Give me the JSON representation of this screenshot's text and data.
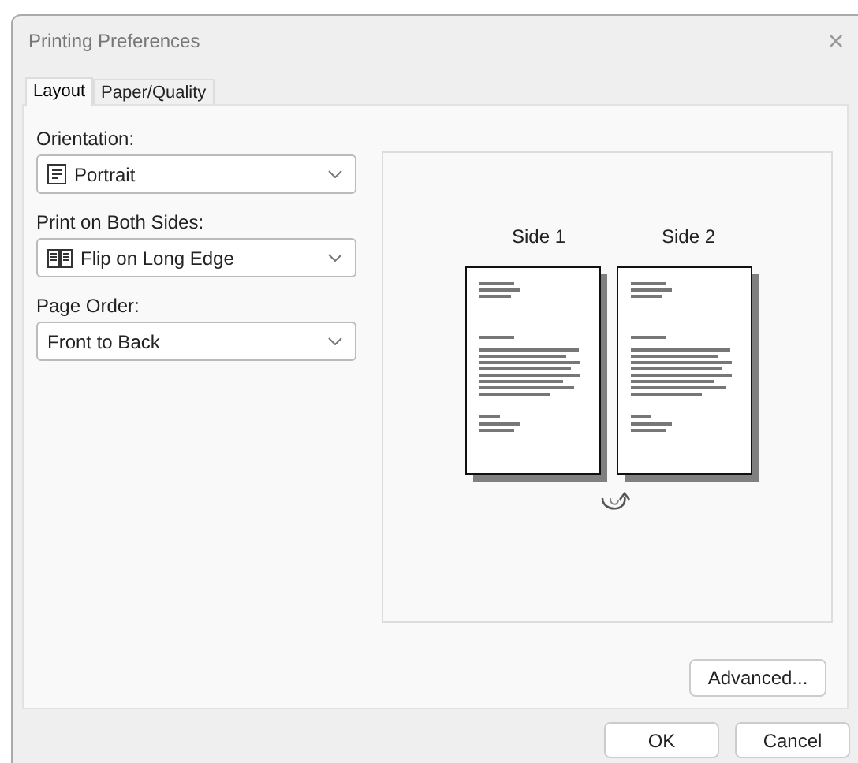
{
  "window": {
    "title": "Printing Preferences",
    "close": "×"
  },
  "tabs": [
    {
      "label": "Layout",
      "selected": true
    },
    {
      "label": "Paper/Quality",
      "selected": false
    }
  ],
  "fields": [
    {
      "label": "Orientation:",
      "value": "Portrait",
      "kind": "portrait"
    },
    {
      "label": "Print on Both Sides:",
      "value": "Flip on Long Edge",
      "kind": "book"
    },
    {
      "label": "Page Order:",
      "value": "Front to Back",
      "kind": "plain"
    }
  ],
  "preview": {
    "pages": [
      {
        "label": "Side 1"
      },
      {
        "label": "Side 2"
      }
    ]
  },
  "advanced_button": "Advanced...",
  "buttons": [
    "OK",
    "Cancel"
  ]
}
